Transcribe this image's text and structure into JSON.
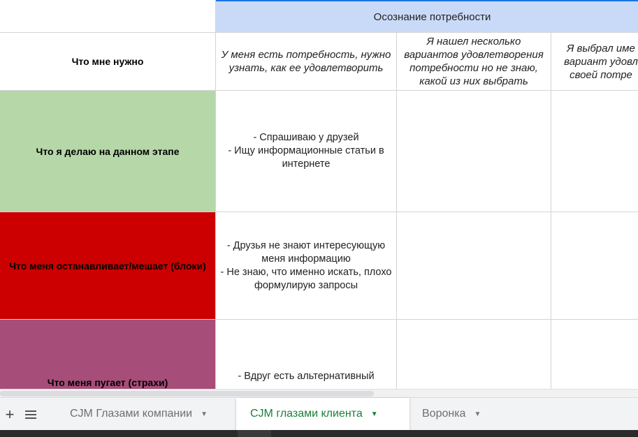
{
  "stage_header": "Осознание потребности",
  "corner_label": "Что мне нужно",
  "columns": [
    "У меня есть потребность, нужно узнать, как ее удовлетворить",
    "Я нашел несколько вариантов удовлетворения потребности но не знаю, какой из них выбрать",
    "Я выбрал име вариант удовл своей потре"
  ],
  "rows": [
    {
      "label": "Что я делаю на данном этапе",
      "color": "#b6d7a8",
      "text": "- Спрашиваю у друзей\n- Ищу информационные статьи в интернете"
    },
    {
      "label": "Что меня останавливает/мешает (блоки)",
      "color": "#cc0000",
      "text": "- Друзья не знают интересующую меня информацию\n- Не знаю, что именно искать, плохо формулирую запросы"
    },
    {
      "label": "Что меня пугает (страхи)",
      "color": "#a64d79",
      "text": "- Вдруг есть альтернативный"
    }
  ],
  "sheet_tabs": [
    {
      "label": "CJM Глазами компании",
      "active": false
    },
    {
      "label": "CJM глазами клиента",
      "active": true
    },
    {
      "label": "Воронка",
      "active": false
    }
  ],
  "icons": {
    "add_sheet": "plus-icon",
    "all_sheets": "menu-icon",
    "tab_menu": "caret-down-icon"
  },
  "colors": {
    "header_blue": "#c9daf8",
    "active_tab_text": "#188038"
  }
}
